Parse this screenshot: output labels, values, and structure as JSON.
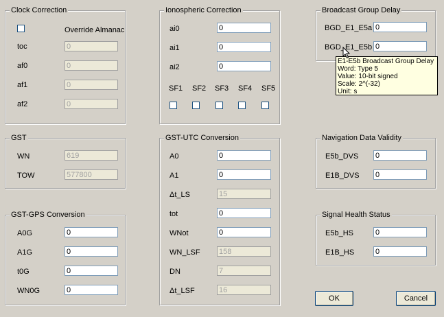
{
  "clock_correction": {
    "title": "Clock Correction",
    "override_label": "Override Almanac",
    "toc": {
      "label": "toc",
      "value": "0"
    },
    "af0": {
      "label": "af0",
      "value": "0"
    },
    "af1": {
      "label": "af1",
      "value": "0"
    },
    "af2": {
      "label": "af2",
      "value": "0"
    }
  },
  "ionospheric": {
    "title": "Ionospheric Correction",
    "ai0": {
      "label": "ai0",
      "value": "0"
    },
    "ai1": {
      "label": "ai1",
      "value": "0"
    },
    "ai2": {
      "label": "ai2",
      "value": "0"
    },
    "sf_labels": [
      "SF1",
      "SF2",
      "SF3",
      "SF4",
      "SF5"
    ]
  },
  "bgd": {
    "title": "Broadcast Group Delay",
    "e1_e5a": {
      "label": "BGD_E1_E5a",
      "value": "0"
    },
    "e1_e5b": {
      "label": "BGD_E1_E5b",
      "value": "0"
    }
  },
  "tooltip": {
    "line1": "E1-E5b Broadcast Group Delay",
    "line2": "Word: Type 5",
    "line3": "Value: 10-bit signed",
    "line4": "Scale: 2^(-32)",
    "line5": "Unit: s"
  },
  "gst": {
    "title": "GST",
    "wn": {
      "label": "WN",
      "value": "619"
    },
    "tow": {
      "label": "TOW",
      "value": "577800"
    }
  },
  "gst_utc": {
    "title": "GST-UTC Conversion",
    "a0": {
      "label": "A0",
      "value": "0"
    },
    "a1": {
      "label": "A1",
      "value": "0"
    },
    "dt_ls": {
      "label": "Δt_LS",
      "value": "15"
    },
    "tot": {
      "label": "tot",
      "value": "0"
    },
    "wnot": {
      "label": "WNot",
      "value": "0"
    },
    "wn_lsf": {
      "label": "WN_LSF",
      "value": "158"
    },
    "dn": {
      "label": "DN",
      "value": "7"
    },
    "dt_lsf": {
      "label": "Δt_LSF",
      "value": "16"
    }
  },
  "gst_gps": {
    "title": "GST-GPS Conversion",
    "a0g": {
      "label": "A0G",
      "value": "0"
    },
    "a1g": {
      "label": "A1G",
      "value": "0"
    },
    "t0g": {
      "label": "t0G",
      "value": "0"
    },
    "wn0g": {
      "label": "WN0G",
      "value": "0"
    }
  },
  "nav_validity": {
    "title": "Navigation Data Validity",
    "e5b_dvs": {
      "label": "E5b_DVS",
      "value": "0"
    },
    "e1b_dvs": {
      "label": "E1B_DVS",
      "value": "0"
    }
  },
  "signal_health": {
    "title": "Signal Health Status",
    "e5b_hs": {
      "label": "E5b_HS",
      "value": "0"
    },
    "e1b_hs": {
      "label": "E1B_HS",
      "value": "0"
    }
  },
  "buttons": {
    "ok": "OK",
    "cancel": "Cancel"
  }
}
